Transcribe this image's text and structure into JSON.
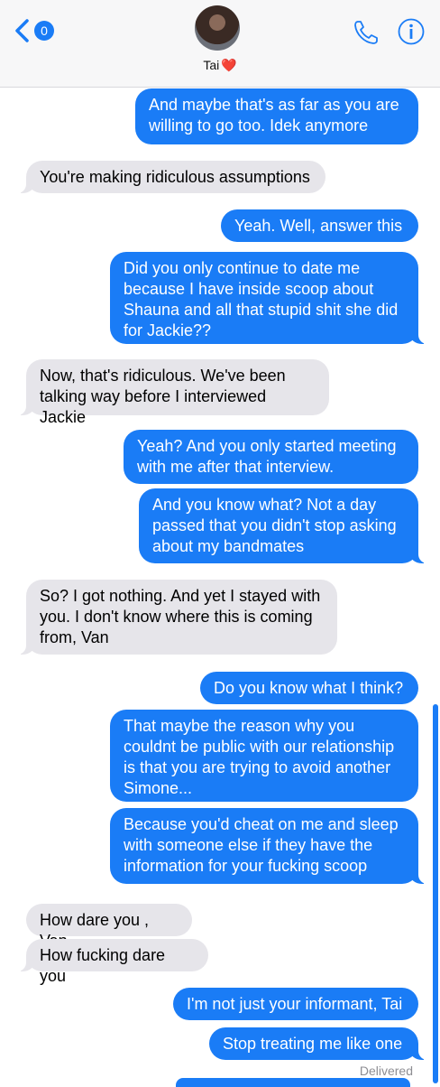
{
  "header": {
    "back_count": "0",
    "contact_name": "Tai",
    "contact_heart": "❤️",
    "icons": [
      "chevron-left-icon",
      "phone-icon",
      "info-icon"
    ],
    "accent_color": "#1a7cf6"
  },
  "messages": [
    {
      "from": "me",
      "text": "And maybe that's as far as you are\nwilling to go too. Idek anymore"
    },
    {
      "from": "them",
      "text": "You're making ridiculous assumptions"
    },
    {
      "from": "me",
      "text": "Yeah. Well, answer this"
    },
    {
      "from": "me",
      "text": "Did you only continue to date me\nbecause I have inside scoop about\nShauna and all that stupid shit she did\nfor Jackie??"
    },
    {
      "from": "them",
      "text": "Now, that's ridiculous. We've been\ntalking way before I interviewed Jackie"
    },
    {
      "from": "me",
      "text": "Yeah? And you only started meeting\nwith me after that interview."
    },
    {
      "from": "me",
      "text": "And you know what? Not a day\npassed that you didn't stop asking\nabout my bandmates"
    },
    {
      "from": "them",
      "text": "So? I got nothing. And yet I stayed with\nyou. I don't know where this is coming\nfrom, Van"
    },
    {
      "from": "me",
      "text": "Do you know what I think?"
    },
    {
      "from": "me",
      "text": "That maybe the reason why you\ncouldnt be public with our relationship\nis that you are trying to avoid another\nSimone..."
    },
    {
      "from": "me",
      "text": "Because you'd cheat on me and sleep\nwith someone else if they have the\ninformation for your fucking scoop"
    },
    {
      "from": "them",
      "text": "How dare you , Van"
    },
    {
      "from": "them",
      "text": "How fucking dare you"
    },
    {
      "from": "me",
      "text": "I'm not just your informant, Tai"
    },
    {
      "from": "me",
      "text": "Stop treating me like one"
    }
  ],
  "status": {
    "delivered": "Delivered"
  }
}
